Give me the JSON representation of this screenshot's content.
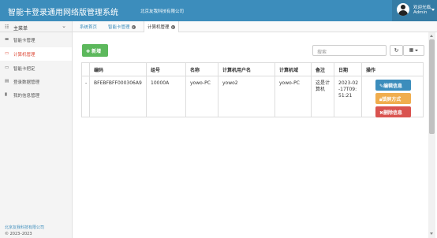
{
  "header": {
    "title": "智能卡登录通用网络版管理系统",
    "company": "北京友我科技有限公司",
    "welcome": "欢迎光临,",
    "username": "Admin"
  },
  "sidebar": {
    "menu_label": "主菜单",
    "items": [
      {
        "label": "智能卡管理",
        "icon": "card-icon"
      },
      {
        "label": "计算机管理",
        "icon": "computer-icon"
      },
      {
        "label": "智能卡把定",
        "icon": "card-bind-icon"
      },
      {
        "label": "登录数据管理",
        "icon": "data-icon"
      },
      {
        "label": "我的信息管理",
        "icon": "user-icon"
      }
    ],
    "footer_company": "北京友我科技有限公司",
    "footer_copyright": "© 2023–2023"
  },
  "tabs": [
    {
      "label": "系统首页"
    },
    {
      "label": "智能卡管理"
    },
    {
      "label": "计算机管理"
    }
  ],
  "toolbar": {
    "add_label": "新增",
    "search_placeholder": "搜索"
  },
  "table": {
    "columns": [
      "编码",
      "组号",
      "名称",
      "计算机用户名",
      "计算机域",
      "备注",
      "日期",
      "操作"
    ],
    "rows": [
      {
        "marker": "-",
        "code": "BFEBFBFF000306A9",
        "group": "10000A",
        "name": "yowo-PC",
        "user": "yowo2",
        "domain": "yowo-PC",
        "note": "这是计算机",
        "date": "2023-02-17T09:51:21"
      }
    ],
    "actions": {
      "edit": "编辑信息",
      "lock": "锁屏方式",
      "delete": "删除信息"
    }
  },
  "colors": {
    "header_bg": "#3c8dbc",
    "add_button": "#5cb85c",
    "edit_button": "#3c8dbc",
    "lock_button": "#f0ad4e",
    "delete_button": "#d9534f",
    "active_nav": "#dd4b39"
  }
}
